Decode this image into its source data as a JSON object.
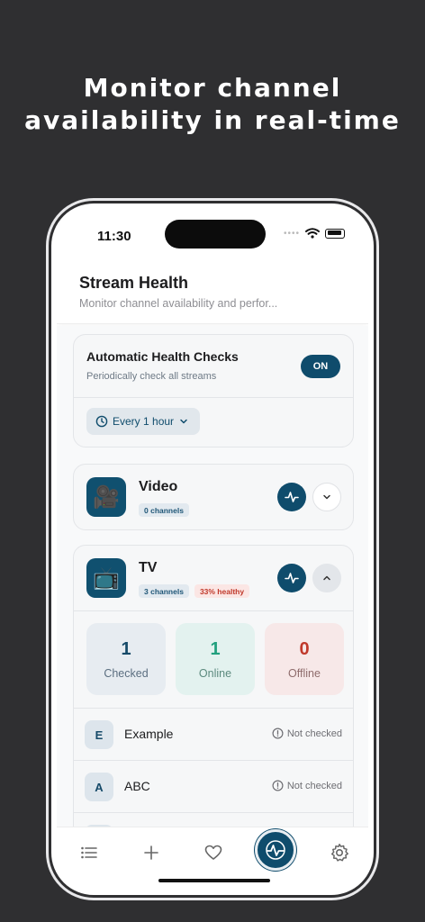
{
  "headline": {
    "line1": "Monitor channel",
    "line2": "availability in real-time"
  },
  "status_bar": {
    "time": "11:30"
  },
  "header": {
    "title": "Stream Health",
    "subtitle": "Monitor channel availability and perfor..."
  },
  "auto_checks": {
    "title": "Automatic Health Checks",
    "subtitle": "Periodically check all streams",
    "toggle_label": "ON",
    "interval_label": "Every 1 hour"
  },
  "categories": [
    {
      "name": "Video",
      "icon": "movie-camera-icon",
      "channels_badge": "0 channels",
      "expanded": false
    },
    {
      "name": "TV",
      "icon": "television-icon",
      "channels_badge": "3 channels",
      "health_badge": "33% healthy",
      "expanded": true,
      "stats": [
        {
          "value": "1",
          "label": "Checked"
        },
        {
          "value": "1",
          "label": "Online"
        },
        {
          "value": "0",
          "label": "Offline"
        }
      ],
      "channels": [
        {
          "letter": "E",
          "name": "Example",
          "status": "Not checked"
        },
        {
          "letter": "A",
          "name": "ABC",
          "status": "Not checked"
        }
      ]
    }
  ],
  "tab_bar": {
    "items": [
      "list-icon",
      "plus-icon",
      "heart-icon",
      "pulse-icon",
      "gear-icon"
    ],
    "active": "pulse-icon"
  },
  "colors": {
    "accent": "#0f4c6c",
    "online": "#22a07e",
    "offline": "#c0392b",
    "background": "#2f2f31"
  }
}
